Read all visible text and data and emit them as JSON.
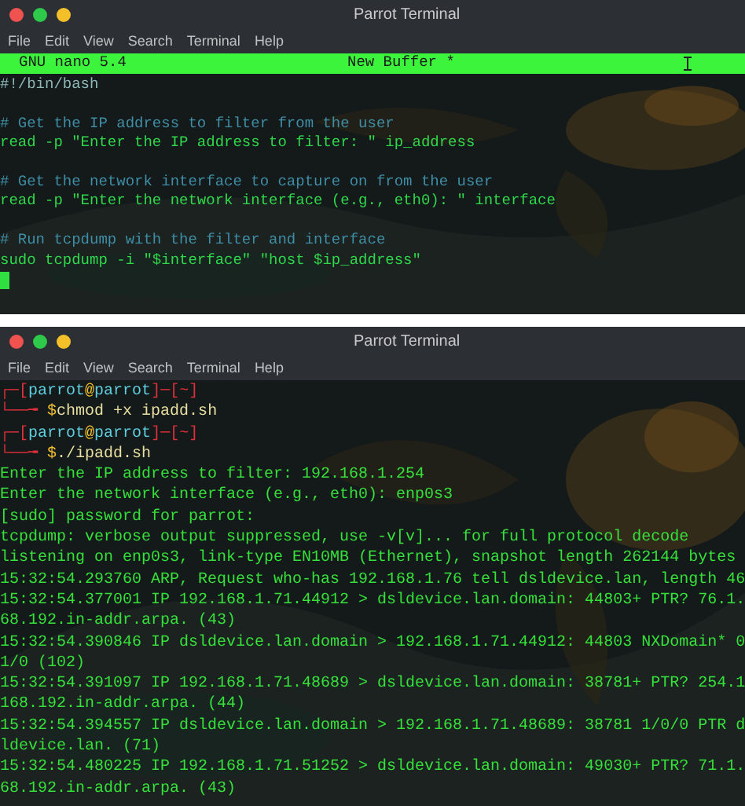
{
  "windows": [
    {
      "title": "Parrot Terminal",
      "menu": [
        "File",
        "Edit",
        "View",
        "Search",
        "Terminal",
        "Help"
      ],
      "nano": {
        "app": "GNU nano 5.4",
        "buffer": "New Buffer *"
      },
      "lines": [
        {
          "kind": "shebang",
          "text": "#!/bin/bash"
        },
        {
          "kind": "blank"
        },
        {
          "kind": "comment",
          "text": "# Get the IP address to filter from the user"
        },
        {
          "kind": "code",
          "text": "read -p \"Enter the IP address to filter: \" ip_address"
        },
        {
          "kind": "blank"
        },
        {
          "kind": "comment",
          "text": "# Get the network interface to capture on from the user"
        },
        {
          "kind": "code",
          "text": "read -p \"Enter the network interface (e.g., eth0): \" interface"
        },
        {
          "kind": "blank"
        },
        {
          "kind": "comment",
          "text": "# Run tcpdump with the filter and interface"
        },
        {
          "kind": "code",
          "text": "sudo tcpdump -i \"$interface\" \"host $ip_address\""
        },
        {
          "kind": "cursor"
        }
      ]
    },
    {
      "title": "Parrot Terminal",
      "menu": [
        "File",
        "Edit",
        "View",
        "Search",
        "Terminal",
        "Help"
      ],
      "lines": [
        {
          "kind": "prompt",
          "parts": [
            {
              "kind": "frame",
              "text": "┌─["
            },
            {
              "kind": "user",
              "text": "parrot"
            },
            {
              "kind": "at",
              "text": "@"
            },
            {
              "kind": "user",
              "text": "parrot"
            },
            {
              "kind": "frame",
              "text": "]─["
            },
            {
              "kind": "frame",
              "text": "~"
            },
            {
              "kind": "frame",
              "text": "]"
            }
          ]
        },
        {
          "kind": "prompt",
          "parts": [
            {
              "kind": "frame",
              "text": "└──╼ "
            },
            {
              "kind": "dollar",
              "text": "$"
            },
            {
              "kind": "command",
              "text": "chmod +x ipadd.sh"
            }
          ]
        },
        {
          "kind": "prompt",
          "parts": [
            {
              "kind": "frame",
              "text": "┌─["
            },
            {
              "kind": "user",
              "text": "parrot"
            },
            {
              "kind": "at",
              "text": "@"
            },
            {
              "kind": "user",
              "text": "parrot"
            },
            {
              "kind": "frame",
              "text": "]─["
            },
            {
              "kind": "frame",
              "text": "~"
            },
            {
              "kind": "frame",
              "text": "]"
            }
          ]
        },
        {
          "kind": "prompt",
          "parts": [
            {
              "kind": "frame",
              "text": "└──╼ "
            },
            {
              "kind": "dollar",
              "text": "$"
            },
            {
              "kind": "command",
              "text": "./ipadd.sh"
            }
          ]
        },
        {
          "kind": "output",
          "text": "Enter the IP address to filter: 192.168.1.254"
        },
        {
          "kind": "output",
          "text": "Enter the network interface (e.g., eth0): enp0s3"
        },
        {
          "kind": "output",
          "text": "[sudo] password for parrot:"
        },
        {
          "kind": "output",
          "text": "tcpdump: verbose output suppressed, use -v[v]... for full protocol decode"
        },
        {
          "kind": "output",
          "text": "listening on enp0s3, link-type EN10MB (Ethernet), snapshot length 262144 bytes"
        },
        {
          "kind": "output",
          "text": "15:32:54.293760 ARP, Request who-has 192.168.1.76 tell dsldevice.lan, length 46"
        },
        {
          "kind": "output",
          "text": "15:32:54.377001 IP 192.168.1.71.44912 > dsldevice.lan.domain: 44803+ PTR? 76.1."
        },
        {
          "kind": "output",
          "text": "68.192.in-addr.arpa. (43)"
        },
        {
          "kind": "output",
          "text": "15:32:54.390846 IP dsldevice.lan.domain > 192.168.1.71.44912: 44803 NXDomain* 0"
        },
        {
          "kind": "output",
          "text": "1/0 (102)"
        },
        {
          "kind": "output",
          "text": "15:32:54.391097 IP 192.168.1.71.48689 > dsldevice.lan.domain: 38781+ PTR? 254.1"
        },
        {
          "kind": "output",
          "text": "168.192.in-addr.arpa. (44)"
        },
        {
          "kind": "output",
          "text": "15:32:54.394557 IP dsldevice.lan.domain > 192.168.1.71.48689: 38781 1/0/0 PTR d"
        },
        {
          "kind": "output",
          "text": "ldevice.lan. (71)"
        },
        {
          "kind": "output",
          "text": "15:32:54.480225 IP 192.168.1.71.51252 > dsldevice.lan.domain: 49030+ PTR? 71.1."
        },
        {
          "kind": "output",
          "text": "68.192.in-addr.arpa. (43)"
        }
      ]
    }
  ]
}
